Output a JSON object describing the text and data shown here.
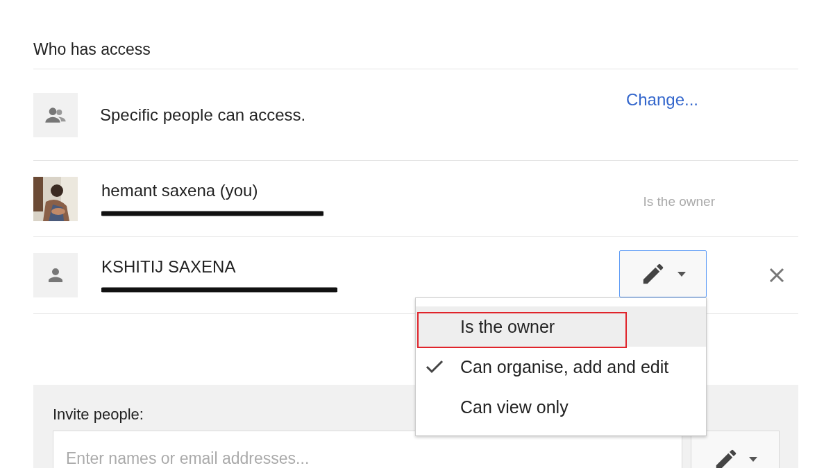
{
  "section_title": "Who has access",
  "access": {
    "description": "Specific people can access.",
    "change_link": "Change..."
  },
  "people": [
    {
      "name": "hemant saxena (you)",
      "has_photo": true,
      "email_hidden": true,
      "role_label": "Is the owner",
      "removable": false
    },
    {
      "name": "KSHITIJ SAXENA",
      "has_photo": false,
      "email_hidden": true,
      "removable": true,
      "permission_menu": {
        "open": true,
        "options": [
          {
            "label": "Is the owner",
            "checked": false,
            "highlighted": true,
            "outlined": true
          },
          {
            "label": "Can organise, add and edit",
            "checked": true,
            "highlighted": false,
            "outlined": false
          },
          {
            "label": "Can view only",
            "checked": false,
            "highlighted": false,
            "outlined": false
          }
        ]
      }
    }
  ],
  "invite": {
    "label": "Invite people:",
    "placeholder": "Enter names or email addresses..."
  }
}
